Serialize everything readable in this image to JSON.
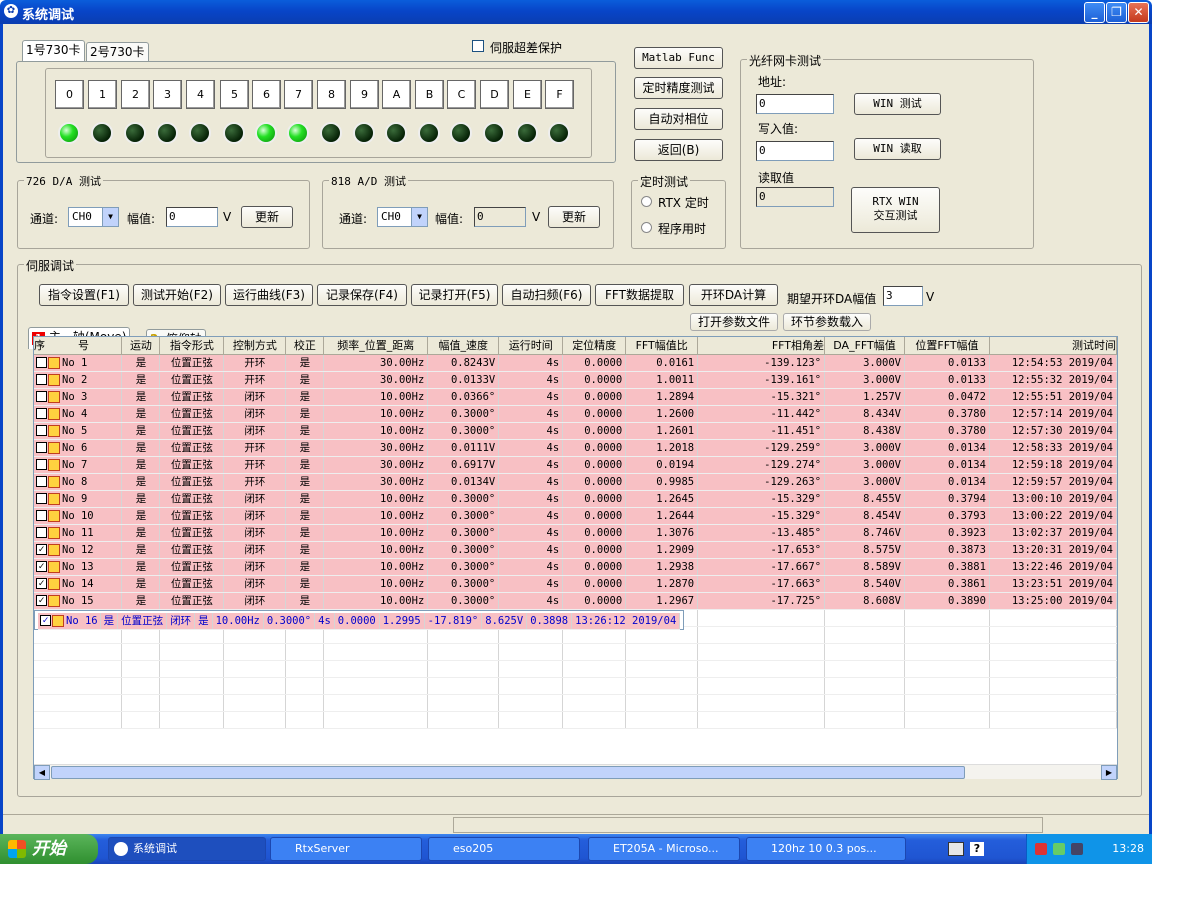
{
  "window": {
    "title": "系统调试"
  },
  "card_tabs": [
    "1号730卡",
    "2号730卡"
  ],
  "servo_protect": {
    "label": "伺服超差保护"
  },
  "channel_buttons": [
    "0",
    "1",
    "2",
    "3",
    "4",
    "5",
    "6",
    "7",
    "8",
    "9",
    "A",
    "B",
    "C",
    "D",
    "E",
    "F"
  ],
  "leds_on": [
    true,
    false,
    false,
    false,
    false,
    false,
    true,
    true,
    false,
    false,
    false,
    false,
    false,
    false,
    false,
    false
  ],
  "right_buttons": {
    "matlab": "Matlab Func",
    "timing": "定时精度测试",
    "auto_phase": "自动对相位",
    "back": "返回(B)"
  },
  "fiber": {
    "caption": "光纤网卡测试",
    "addr_label": "地址:",
    "addr_value": "0",
    "write_label": "写入值:",
    "write_value": "0",
    "read_label": "读取值",
    "read_value": "0",
    "win_test": "WIN 测试",
    "win_read": "WIN 读取",
    "rtx_win": "RTX WIN\n交互测试"
  },
  "da": {
    "caption": "726 D/A 测试",
    "channel_label": "通道:",
    "channel_value": "CH0",
    "amp_label": "幅值:",
    "amp_value": "0",
    "unit": "V",
    "update": "更新"
  },
  "ad": {
    "caption": "818 A/D 测试",
    "channel_label": "通道:",
    "channel_value": "CH0",
    "amp_label": "幅值:",
    "amp_value": "0",
    "unit": "V",
    "update": "更新"
  },
  "timer": {
    "caption": "定时测试",
    "opt1": "RTX 定时",
    "opt2": "程序用时"
  },
  "servo": {
    "caption": "伺服调试",
    "buttons": [
      "指令设置(F1)",
      "测试开始(F2)",
      "运行曲线(F3)",
      "记录保存(F4)",
      "记录打开(F5)",
      "自动扫频(F6)",
      "FFT数据提取",
      "开环DA计算"
    ],
    "expect_label": "期望开环DA幅值",
    "expect_value": "3",
    "expect_unit": "V",
    "open_params": "打开参数文件",
    "loop_params": "环节参数载入"
  },
  "axis_tabs": [
    {
      "num": "1",
      "label": "主　轴(Move)"
    },
    {
      "num": "2",
      "label": "俯仰轴"
    }
  ],
  "table": {
    "headers": [
      "序　　　号",
      "运动",
      "指令形式",
      "控制方式",
      "校正",
      "频率_位置_距离",
      "幅值_速度",
      "运行时间",
      "定位精度",
      "FFT幅值比",
      "FFT相角差",
      "DA_FFT幅值",
      "位置FFT幅值",
      "测试时间"
    ],
    "rows": [
      [
        "No 1",
        "是",
        "位置正弦",
        "开环",
        "是",
        "30.00Hz",
        "0.8243V",
        "4s",
        "0.0000",
        "0.0161",
        "-139.123°",
        "3.000V",
        "0.0133",
        "12:54:53 2019/04",
        false
      ],
      [
        "No 2",
        "是",
        "位置正弦",
        "开环",
        "是",
        "30.00Hz",
        "0.0133V",
        "4s",
        "0.0000",
        "1.0011",
        "-139.161°",
        "3.000V",
        "0.0133",
        "12:55:32 2019/04",
        false
      ],
      [
        "No 3",
        "是",
        "位置正弦",
        "闭环",
        "是",
        "10.00Hz",
        "0.0366°",
        "4s",
        "0.0000",
        "1.2894",
        "-15.321°",
        "1.257V",
        "0.0472",
        "12:55:51 2019/04",
        false
      ],
      [
        "No 4",
        "是",
        "位置正弦",
        "闭环",
        "是",
        "10.00Hz",
        "0.3000°",
        "4s",
        "0.0000",
        "1.2600",
        "-11.442°",
        "8.434V",
        "0.3780",
        "12:57:14 2019/04",
        false
      ],
      [
        "No 5",
        "是",
        "位置正弦",
        "闭环",
        "是",
        "10.00Hz",
        "0.3000°",
        "4s",
        "0.0000",
        "1.2601",
        "-11.451°",
        "8.438V",
        "0.3780",
        "12:57:30 2019/04",
        false
      ],
      [
        "No 6",
        "是",
        "位置正弦",
        "开环",
        "是",
        "30.00Hz",
        "0.0111V",
        "4s",
        "0.0000",
        "1.2018",
        "-129.259°",
        "3.000V",
        "0.0134",
        "12:58:33 2019/04",
        false
      ],
      [
        "No 7",
        "是",
        "位置正弦",
        "开环",
        "是",
        "30.00Hz",
        "0.6917V",
        "4s",
        "0.0000",
        "0.0194",
        "-129.274°",
        "3.000V",
        "0.0134",
        "12:59:18 2019/04",
        false
      ],
      [
        "No 8",
        "是",
        "位置正弦",
        "开环",
        "是",
        "30.00Hz",
        "0.0134V",
        "4s",
        "0.0000",
        "0.9985",
        "-129.263°",
        "3.000V",
        "0.0134",
        "12:59:57 2019/04",
        false
      ],
      [
        "No 9",
        "是",
        "位置正弦",
        "闭环",
        "是",
        "10.00Hz",
        "0.3000°",
        "4s",
        "0.0000",
        "1.2645",
        "-15.329°",
        "8.455V",
        "0.3794",
        "13:00:10 2019/04",
        false
      ],
      [
        "No 10",
        "是",
        "位置正弦",
        "闭环",
        "是",
        "10.00Hz",
        "0.3000°",
        "4s",
        "0.0000",
        "1.2644",
        "-15.329°",
        "8.454V",
        "0.3793",
        "13:00:22 2019/04",
        false
      ],
      [
        "No 11",
        "是",
        "位置正弦",
        "闭环",
        "是",
        "10.00Hz",
        "0.3000°",
        "4s",
        "0.0000",
        "1.3076",
        "-13.485°",
        "8.746V",
        "0.3923",
        "13:02:37 2019/04",
        false
      ],
      [
        "No 12",
        "是",
        "位置正弦",
        "闭环",
        "是",
        "10.00Hz",
        "0.3000°",
        "4s",
        "0.0000",
        "1.2909",
        "-17.653°",
        "8.575V",
        "0.3873",
        "13:20:31 2019/04",
        true
      ],
      [
        "No 13",
        "是",
        "位置正弦",
        "闭环",
        "是",
        "10.00Hz",
        "0.3000°",
        "4s",
        "0.0000",
        "1.2938",
        "-17.667°",
        "8.589V",
        "0.3881",
        "13:22:46 2019/04",
        true
      ],
      [
        "No 14",
        "是",
        "位置正弦",
        "闭环",
        "是",
        "10.00Hz",
        "0.3000°",
        "4s",
        "0.0000",
        "1.2870",
        "-17.663°",
        "8.540V",
        "0.3861",
        "13:23:51 2019/04",
        true
      ],
      [
        "No 15",
        "是",
        "位置正弦",
        "闭环",
        "是",
        "10.00Hz",
        "0.3000°",
        "4s",
        "0.0000",
        "1.2967",
        "-17.725°",
        "8.608V",
        "0.3890",
        "13:25:00 2019/04",
        true
      ],
      [
        "No 16",
        "是",
        "位置正弦",
        "闭环",
        "是",
        "10.00Hz",
        "0.3000°",
        "4s",
        "0.0000",
        "1.2995",
        "-17.819°",
        "8.625V",
        "0.3898",
        "13:26:12 2019/04",
        true
      ]
    ]
  },
  "taskbar": {
    "start": "开始",
    "tasks": [
      "系统调试",
      "RtxServer",
      "eso205",
      "ET205A - Microso...",
      "120hz 10 0.3 pos..."
    ],
    "clock": "13:28"
  }
}
